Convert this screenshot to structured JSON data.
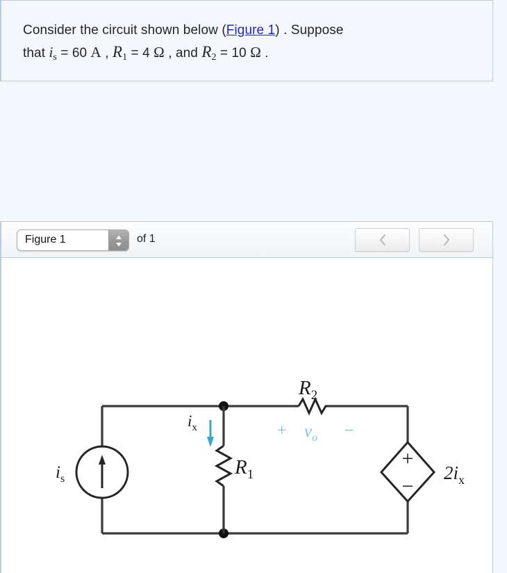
{
  "problem": {
    "line1_a": "Consider the circuit shown below (",
    "figure_link": "Figure 1",
    "line1_b": ") . Suppose",
    "line2_a": "that ",
    "var_is": "i",
    "var_is_sub": "s",
    "eq1": " = 60  ",
    "unit_amp": "A",
    "sep1": " , ",
    "var_r1": "R",
    "var_r1_sub": "1",
    "eq2": " = 4 ",
    "unit_ohm": "Ω",
    "sep2": " , and ",
    "var_r2": "R",
    "var_r2_sub": "2",
    "eq3": " = 10 ",
    "unit_ohm2": "Ω",
    "period": " ."
  },
  "figure_toolbar": {
    "selected_figure": "Figure 1",
    "of_label": "of 1",
    "prev_icon": "chevron-left-icon",
    "next_icon": "chevron-right-icon",
    "stepper_icon": "stepper-updown-icon"
  },
  "circuit": {
    "source_label": "i",
    "source_label_sub": "s",
    "source_icon": "current-source-arrow-up",
    "r1_label": "R",
    "r1_label_sub": "1",
    "r2_label": "R",
    "r2_label_sub": "2",
    "ix_label": "i",
    "ix_label_sub": "x",
    "ix_arrow_icon": "down-arrow-icon",
    "vo_plus": "+",
    "vo_label": "v",
    "vo_label_sub": "o",
    "vo_minus": "−",
    "dep_source_plus": "+",
    "dep_source_minus": "−",
    "dep_source_label": "2i",
    "dep_source_label_sub": "x",
    "colors": {
      "wire": "#3b3b3b",
      "ix_arrow": "#3aa8cc",
      "vo_text": "#7cc5dd",
      "link": "#2323cc"
    }
  }
}
